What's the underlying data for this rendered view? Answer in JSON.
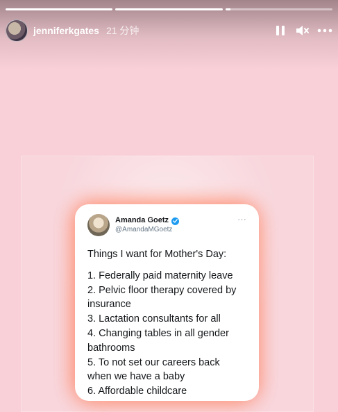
{
  "story": {
    "progress_segments": [
      {
        "filled": 1.0
      },
      {
        "filled": 1.0
      },
      {
        "filled": 0.05
      }
    ],
    "username": "jenniferkgates",
    "time_ago": "21 分钟",
    "controls": {
      "pause_icon": "pause-icon",
      "mute_icon": "speaker-muted-icon",
      "more_icon": "more-horizontal-icon"
    }
  },
  "tweet": {
    "author_name": "Amanda Goetz",
    "author_handle": "@AmandaMGoetz",
    "more_label": "···",
    "verified_color": "#1d9bf0",
    "intro": "Things I want for Mother's Day:",
    "list": [
      "1. Federally paid maternity leave",
      "2. Pelvic floor therapy covered by insurance",
      "3. Lactation consultants for all",
      "4. Changing tables in all gender bathrooms",
      "5. To not set our careers back when we have a baby",
      "6. Affordable childcare"
    ]
  },
  "colors": {
    "background": "#f9d0d8",
    "glow": "#ff7b55"
  }
}
